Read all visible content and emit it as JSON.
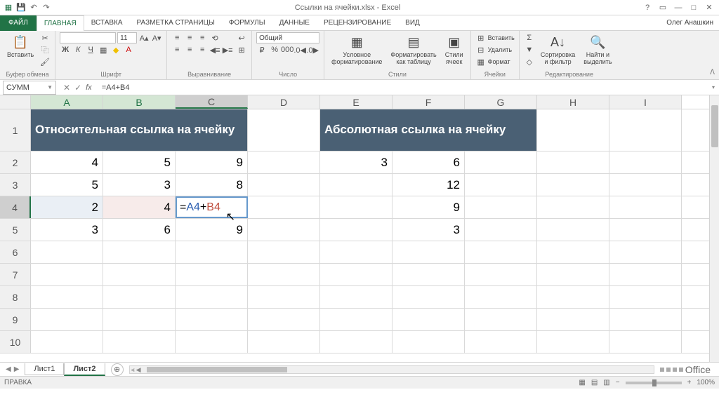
{
  "title": "Ссылки на ячейки.xlsx - Excel",
  "user": "Олег Анашкин",
  "tabs": {
    "file": "ФАЙЛ",
    "home": "ГЛАВНАЯ",
    "insert": "ВСТАВКА",
    "pagelayout": "РАЗМЕТКА СТРАНИЦЫ",
    "formulas": "ФОРМУЛЫ",
    "data": "ДАННЫЕ",
    "review": "РЕЦЕНЗИРОВАНИЕ",
    "view": "ВИД"
  },
  "ribbon": {
    "clipboard": {
      "paste": "Вставить",
      "group": "Буфер обмена"
    },
    "font": {
      "size": "11",
      "group": "Шрифт"
    },
    "align": {
      "group": "Выравнивание"
    },
    "number": {
      "format": "Общий",
      "group": "Число"
    },
    "styles": {
      "cond": "Условное\nформатирование",
      "table": "Форматировать\nкак таблицу",
      "cell": "Стили\nячеек",
      "group": "Стили"
    },
    "cells": {
      "insert": "Вставить",
      "delete": "Удалить",
      "format": "Формат",
      "group": "Ячейки"
    },
    "editing": {
      "sort": "Сортировка\nи фильтр",
      "find": "Найти и\nвыделить",
      "group": "Редактирование"
    }
  },
  "namebox": "СУММ",
  "formula": "=A4+B4",
  "cols": [
    "A",
    "B",
    "C",
    "D",
    "E",
    "F",
    "G",
    "H",
    "I"
  ],
  "rows": [
    "1",
    "2",
    "3",
    "4",
    "5",
    "6",
    "7",
    "8",
    "9",
    "10"
  ],
  "cells": {
    "header1": "Относительная ссылка на ячейку",
    "header2": "Абсолютная ссылка на ячейку",
    "a2": "4",
    "b2": "5",
    "c2": "9",
    "a3": "5",
    "b3": "3",
    "c3": "8",
    "a4": "2",
    "b4": "4",
    "a5": "3",
    "b5": "6",
    "c5": "9",
    "e2": "3",
    "f2": "6",
    "f3": "12",
    "f4": "9",
    "f5": "3"
  },
  "editing": {
    "eq": "=",
    "refa": "A4",
    "plus": "+",
    "refb": "B4"
  },
  "sheets": {
    "s1": "Лист1",
    "s2": "Лист2"
  },
  "status": "ПРАВКА",
  "zoom": "100%"
}
